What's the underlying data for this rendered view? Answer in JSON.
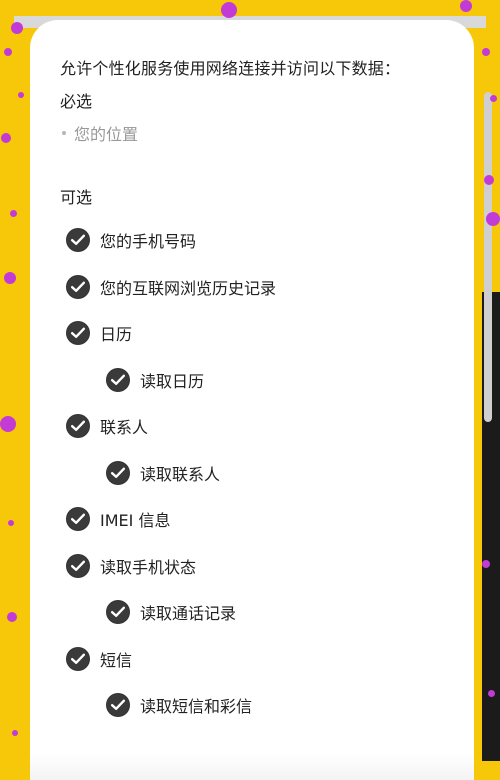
{
  "permissions": {
    "intro": "允许个性化服务使用网络连接并访问以下数据：",
    "required": {
      "heading": "必选",
      "items": [
        "您的位置"
      ]
    },
    "optional": {
      "heading": "可选",
      "items": [
        {
          "label": "您的手机号码",
          "level": 1,
          "checked": true
        },
        {
          "label": "您的互联网浏览历史记录",
          "level": 1,
          "checked": true
        },
        {
          "label": "日历",
          "level": 1,
          "checked": true
        },
        {
          "label": "读取日历",
          "level": 2,
          "checked": true
        },
        {
          "label": "联系人",
          "level": 1,
          "checked": true
        },
        {
          "label": "读取联系人",
          "level": 2,
          "checked": true
        },
        {
          "label": "IMEI 信息",
          "level": 1,
          "checked": true
        },
        {
          "label": "读取手机状态",
          "level": 1,
          "checked": true
        },
        {
          "label": "读取通话记录",
          "level": 2,
          "checked": true
        },
        {
          "label": "短信",
          "level": 1,
          "checked": true
        },
        {
          "label": "读取短信和彩信",
          "level": 2,
          "checked": true
        }
      ]
    }
  },
  "colors": {
    "background": "#f7c70a",
    "confetti": "#c33bd6",
    "card": "#ffffff",
    "check_fill": "#3a3a3a",
    "text_primary": "#222222",
    "text_secondary": "#999999"
  }
}
